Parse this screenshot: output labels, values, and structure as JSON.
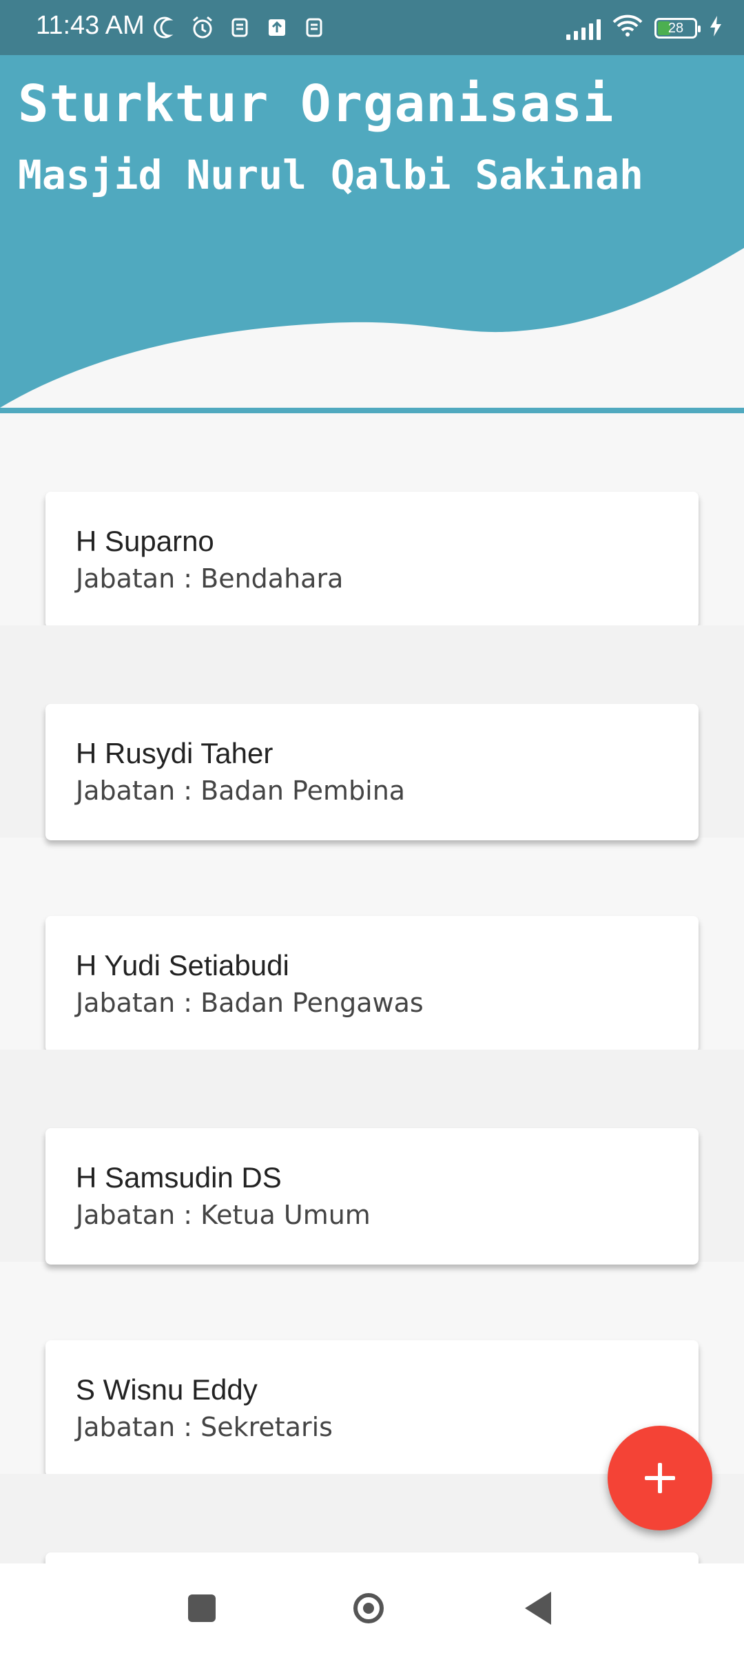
{
  "status_bar": {
    "time": "11:43 AM",
    "battery": "28",
    "icons_left": [
      "moon-icon",
      "alarm-icon",
      "notification-icon",
      "upload-icon",
      "notification-icon"
    ],
    "icons_right": [
      "signal-icon",
      "wifi-icon",
      "battery-icon",
      "charging-icon"
    ]
  },
  "header": {
    "title": "Sturktur Organisasi",
    "subtitle": "Masjid Nurul Qalbi Sakinah",
    "color": "#50a9bf"
  },
  "members": [
    {
      "name": "H Suparno",
      "role": "Jabatan : Bendahara"
    },
    {
      "name": "H Rusydi Taher",
      "role": "Jabatan : Badan Pembina"
    },
    {
      "name": "H Yudi Setiabudi",
      "role": "Jabatan : Badan Pengawas"
    },
    {
      "name": "H Samsudin DS",
      "role": "Jabatan : Ketua Umum"
    },
    {
      "name": "S Wisnu Eddy",
      "role": "Jabatan : Sekretaris"
    },
    {
      "name": "",
      "role": ""
    }
  ],
  "fab": {
    "icon": "plus-icon",
    "color": "#f44336"
  },
  "navbar": {
    "icons": [
      "recents-icon",
      "home-icon",
      "back-icon"
    ]
  }
}
